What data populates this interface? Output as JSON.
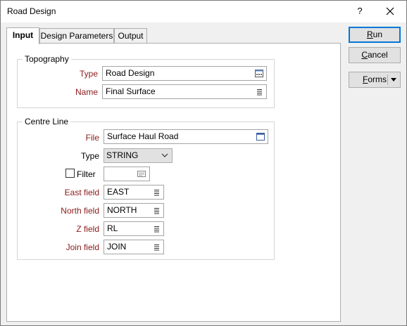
{
  "window": {
    "title": "Road Design",
    "help_label": "?",
    "close_label": "✕"
  },
  "tabs": [
    {
      "label": "Input",
      "active": true
    },
    {
      "label": "Design Parameters",
      "active": false
    },
    {
      "label": "Output",
      "active": false
    }
  ],
  "topography": {
    "group_title": "Topography",
    "type_label": "Type",
    "type_value": "Road Design",
    "name_label": "Name",
    "name_value": "Final Surface"
  },
  "centre_line": {
    "group_title": "Centre Line",
    "file_label": "File",
    "file_value": "Surface Haul Road",
    "type_label": "Type",
    "type_value": "STRING",
    "filter_label": "Filter",
    "filter_checked": false,
    "filter_value": "",
    "east_label": "East field",
    "east_value": "EAST",
    "north_label": "North field",
    "north_value": "NORTH",
    "z_label": "Z field",
    "z_value": "RL",
    "join_label": "Join field",
    "join_value": "JOIN"
  },
  "buttons": {
    "run_first": "R",
    "run_rest": "un",
    "cancel_first": "C",
    "cancel_rest": "ancel",
    "forms_first": "F",
    "forms_rest": "orms"
  },
  "colors": {
    "required_label": "#8b1a1a",
    "default_button_border": "#0078d7"
  },
  "icons": {
    "browse": "ellipsis-box-icon",
    "list": "list-icon",
    "file_browse": "file-browse-icon",
    "filter": "filter-expression-icon",
    "dropdown": "chevron-down-icon"
  }
}
